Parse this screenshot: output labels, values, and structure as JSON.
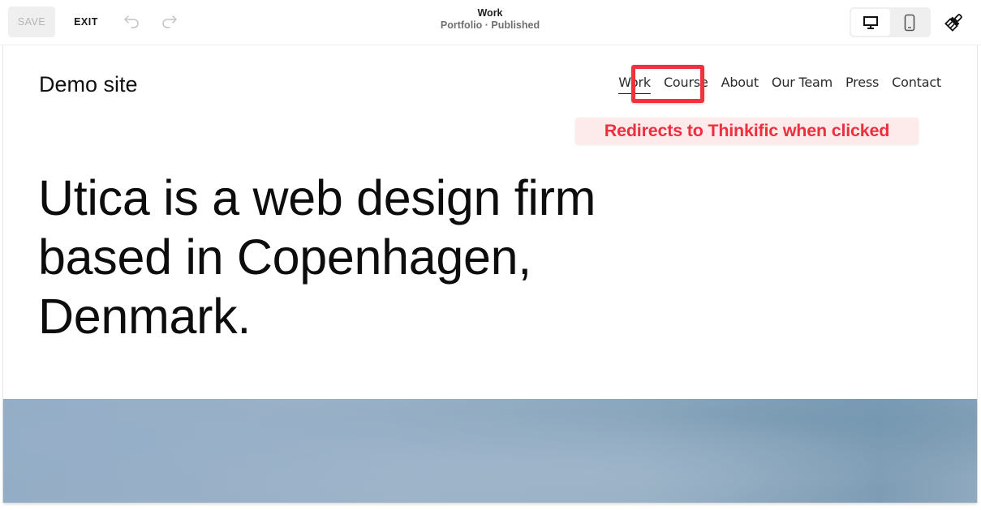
{
  "editor_toolbar": {
    "save_label": "SAVE",
    "exit_label": "EXIT",
    "undo_icon": "undo-icon",
    "redo_icon": "redo-icon",
    "page_title": "Work",
    "page_subtitle": "Portfolio · Published",
    "device_options": [
      {
        "name": "desktop",
        "icon": "desktop-icon",
        "selected": true
      },
      {
        "name": "mobile",
        "icon": "mobile-icon",
        "selected": false
      }
    ],
    "design_icon": "paintbrush-icon"
  },
  "site": {
    "title": "Demo site",
    "nav": [
      {
        "label": "Work",
        "active": true
      },
      {
        "label": "Course",
        "active": false
      },
      {
        "label": "About",
        "active": false
      },
      {
        "label": "Our Team",
        "active": false
      },
      {
        "label": "Press",
        "active": false
      },
      {
        "label": "Contact",
        "active": false
      }
    ],
    "hero_lines": [
      "Utica is a web design firm",
      "based in Copenhagen,",
      "Denmark."
    ]
  },
  "annotation": {
    "label": "Redirects to Thinkific when clicked",
    "color": "#f0323f",
    "target": "Course"
  },
  "colors": {
    "annotation_red": "#f0323f",
    "annotation_bg": "#fdebec",
    "hero_image_blue": "#94adc6"
  }
}
